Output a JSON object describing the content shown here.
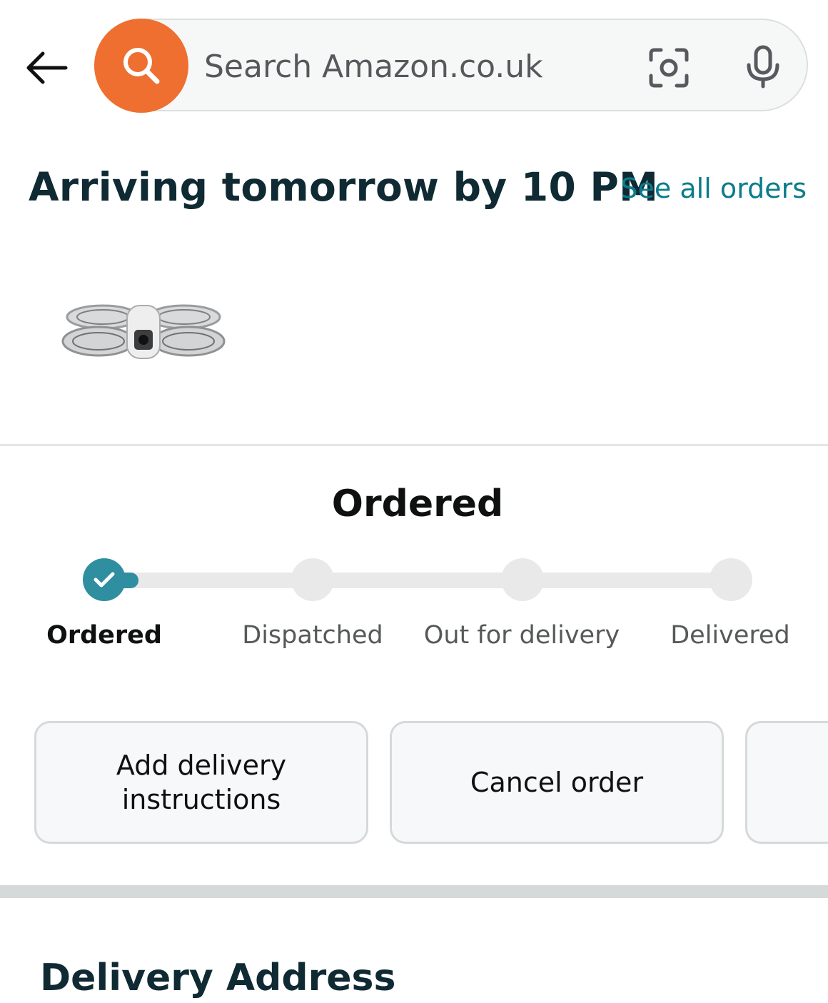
{
  "header": {
    "search_placeholder": "Search Amazon.co.uk"
  },
  "delivery": {
    "arriving_text": "Arriving tomorrow by 10 PM",
    "see_all_label": "See all orders"
  },
  "status": {
    "current": "Ordered",
    "progress_step": 1,
    "steps": [
      {
        "label": "Ordered",
        "state": "complete"
      },
      {
        "label": "Dispatched",
        "state": "pending"
      },
      {
        "label": "Out for delivery",
        "state": "pending"
      },
      {
        "label": "Delivered",
        "state": "pending"
      }
    ]
  },
  "actions": {
    "add_instructions_line1": "Add delivery",
    "add_instructions_line2": "instructions",
    "cancel_label": "Cancel order"
  },
  "address": {
    "title": "Delivery Address"
  },
  "colors": {
    "search_accent": "#ee6f30",
    "progress_accent": "#2f8ea0",
    "link": "#0a7c8c"
  },
  "icons": {
    "back": "arrow-left-icon",
    "search": "search-icon",
    "camera": "camera-scan-icon",
    "mic": "microphone-icon",
    "check": "check-icon"
  }
}
